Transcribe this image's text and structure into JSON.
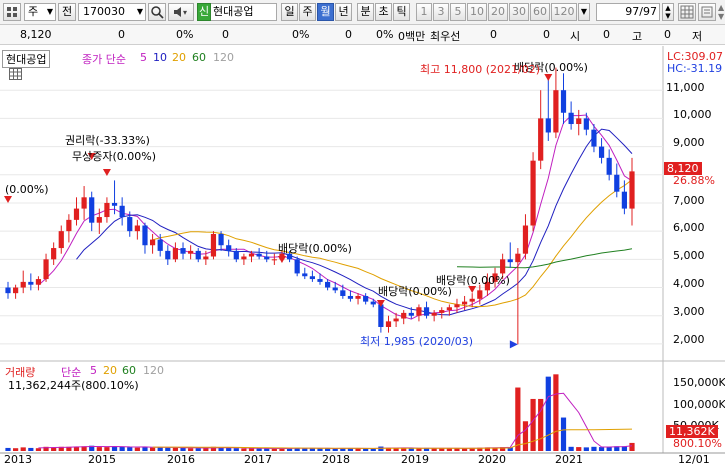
{
  "toolbar": {
    "window_icon": "grid-menu-icon",
    "market_select": "주",
    "prev_label": "전",
    "code_input": "170030",
    "stock_badge": "신",
    "stock_name": "현대공업",
    "periods": [
      "일",
      "주",
      "월",
      "년",
      "분",
      "초",
      "틱"
    ],
    "selected_period": "월",
    "intervals": [
      "1",
      "3",
      "5",
      "10",
      "20",
      "30",
      "60",
      "120"
    ],
    "count_value": "97/97"
  },
  "infobar": {
    "price": "8,120",
    "change": "0",
    "change_rate": "0%",
    "volume": "0",
    "volume_rate": "0%",
    "amount": "0",
    "amount_rate": "0%",
    "amount_unit": "0백만",
    "best_ask_label": "최우선",
    "best_ask": "0",
    "field1": "0",
    "open_label": "시",
    "open": "0",
    "high_label": "고",
    "high": "0",
    "low_label": "저"
  },
  "price_panel": {
    "stock_label": "현대공업",
    "ma_title": "종가 단순",
    "ma_periods": [
      "5",
      "10",
      "20",
      "60",
      "120"
    ],
    "ma_colors": [
      "#c020c0",
      "#2020c0",
      "#e0a000",
      "#208020",
      "#a0a0a0"
    ],
    "top_right_1": "LC:309.07",
    "top_right_2": "HC:-31.19",
    "current_price_tag": "8,120",
    "current_pct_tag": "26.88%",
    "y_ticks": [
      "11,000",
      "10,000",
      "9,000",
      "8,000",
      "7,000",
      "6,000",
      "5,000",
      "4,000",
      "3,000",
      "2,000"
    ],
    "annotations": {
      "a1": "(0.00%)",
      "a2": "권리락(-33.33%)",
      "a3": "무상증자(0.00%)",
      "a4": "배당락(0.00%)",
      "a5": "배당락(0.00%)",
      "a6": "배당락(0.00%)",
      "a7": "배당락(0.00%)",
      "a8": "최고 11,800 (2021/02)",
      "a9": "최저 1,985 (2020/03)"
    }
  },
  "volume_panel": {
    "title": "거래량",
    "ma_title": "단순",
    "ma_periods": [
      "5",
      "20",
      "60",
      "120"
    ],
    "summary": "11,362,244주(800.10%)",
    "y_ticks": [
      "150,000K",
      "100,000K",
      "50,000K"
    ],
    "current_tag": "11,362K",
    "pct_tag": "800.10%"
  },
  "x_axis": [
    "2013",
    "2015",
    "2016",
    "2017",
    "2018",
    "2019",
    "2020",
    "2021",
    "12/01"
  ],
  "chart_data": {
    "type": "candlestick",
    "y_range": [
      1500,
      12000
    ],
    "volume_range": [
      0,
      170000
    ],
    "months": 97,
    "candles_approx": [
      [
        4000,
        4200,
        3600,
        3800
      ],
      [
        3800,
        4100,
        3600,
        4000
      ],
      [
        4000,
        4600,
        3800,
        4200
      ],
      [
        4200,
        4500,
        3900,
        4100
      ],
      [
        4100,
        4400,
        3900,
        4300
      ],
      [
        4300,
        5200,
        4200,
        5000
      ],
      [
        5000,
        5600,
        4800,
        5400
      ],
      [
        5400,
        6200,
        5200,
        6000
      ],
      [
        6000,
        6600,
        5600,
        6400
      ],
      [
        6400,
        7200,
        6200,
        6800
      ],
      [
        6800,
        7600,
        6400,
        7200
      ],
      [
        7200,
        7400,
        6000,
        6300
      ],
      [
        6300,
        6800,
        5900,
        6500
      ],
      [
        6500,
        7200,
        6300,
        7000
      ],
      [
        7000,
        7800,
        6600,
        6900
      ],
      [
        6900,
        7200,
        6200,
        6500
      ],
      [
        6500,
        6700,
        5800,
        6000
      ],
      [
        6000,
        6400,
        5700,
        6200
      ],
      [
        6200,
        6300,
        5200,
        5500
      ],
      [
        5500,
        5900,
        5200,
        5700
      ],
      [
        5700,
        5900,
        5100,
        5300
      ],
      [
        5300,
        5500,
        4800,
        5000
      ],
      [
        5000,
        5600,
        4900,
        5400
      ],
      [
        5400,
        5600,
        5000,
        5200
      ],
      [
        5200,
        5500,
        5000,
        5300
      ],
      [
        5300,
        5400,
        4900,
        5000
      ],
      [
        5000,
        5300,
        4800,
        5100
      ],
      [
        5100,
        6000,
        5000,
        5900
      ],
      [
        5900,
        6000,
        5300,
        5500
      ],
      [
        5500,
        5700,
        5100,
        5300
      ],
      [
        5300,
        5400,
        4900,
        5000
      ],
      [
        5000,
        5200,
        4800,
        5100
      ],
      [
        5100,
        5300,
        4900,
        5200
      ],
      [
        5200,
        5400,
        5000,
        5100
      ],
      [
        5100,
        5300,
        4900,
        5000
      ],
      [
        5000,
        5200,
        4800,
        5000
      ],
      [
        5000,
        5300,
        4900,
        5200
      ],
      [
        5200,
        5300,
        4900,
        5000
      ],
      [
        5000,
        5100,
        4400,
        4500
      ],
      [
        4500,
        4700,
        4300,
        4400
      ],
      [
        4400,
        4600,
        4200,
        4300
      ],
      [
        4300,
        4500,
        4100,
        4200
      ],
      [
        4200,
        4300,
        3900,
        4000
      ],
      [
        4000,
        4200,
        3800,
        3900
      ],
      [
        3900,
        4100,
        3600,
        3700
      ],
      [
        3700,
        3900,
        3500,
        3600
      ],
      [
        3600,
        3800,
        3400,
        3700
      ],
      [
        3700,
        3800,
        3400,
        3500
      ],
      [
        3500,
        3600,
        3300,
        3400
      ],
      [
        3400,
        3500,
        2400,
        2600
      ],
      [
        2600,
        3000,
        2400,
        2800
      ],
      [
        2800,
        3100,
        2600,
        2900
      ],
      [
        2900,
        3200,
        2700,
        3100
      ],
      [
        3100,
        3300,
        2900,
        3000
      ],
      [
        3000,
        3400,
        2800,
        3300
      ],
      [
        3300,
        3500,
        2900,
        3000
      ],
      [
        3000,
        3200,
        2800,
        3100
      ],
      [
        3100,
        3300,
        2900,
        3200
      ],
      [
        3200,
        3400,
        3000,
        3300
      ],
      [
        3300,
        3600,
        3100,
        3400
      ],
      [
        3400,
        3700,
        3200,
        3500
      ],
      [
        3500,
        3800,
        3300,
        3600
      ],
      [
        3600,
        4100,
        3400,
        3900
      ],
      [
        3900,
        4500,
        3700,
        4200
      ],
      [
        4200,
        4700,
        4000,
        4500
      ],
      [
        4500,
        5200,
        4300,
        5000
      ],
      [
        5000,
        5600,
        4700,
        4900
      ],
      [
        4900,
        5400,
        1985,
        5200
      ],
      [
        5200,
        6600,
        5000,
        6200
      ],
      [
        6200,
        8800,
        6000,
        8500
      ],
      [
        8500,
        11000,
        8200,
        10000
      ],
      [
        10000,
        11400,
        9200,
        9500
      ],
      [
        9500,
        11800,
        9300,
        11000
      ],
      [
        11000,
        11600,
        9800,
        10200
      ],
      [
        10200,
        10600,
        9600,
        9800
      ],
      [
        9800,
        10300,
        9400,
        10000
      ],
      [
        10000,
        10200,
        9400,
        9600
      ],
      [
        9600,
        9800,
        8800,
        9000
      ],
      [
        9000,
        9300,
        8400,
        8600
      ],
      [
        8600,
        8900,
        7800,
        8000
      ],
      [
        8000,
        8400,
        7200,
        7400
      ],
      [
        7400,
        7800,
        6600,
        6800
      ],
      [
        6800,
        8600,
        6200,
        8120
      ]
    ]
  }
}
